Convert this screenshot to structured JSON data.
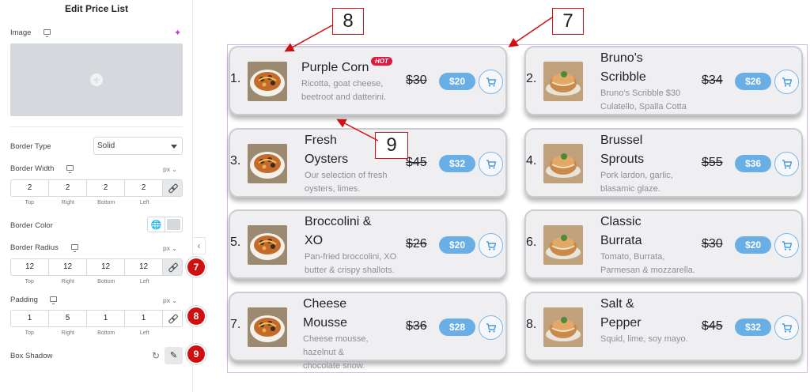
{
  "panel": {
    "title": "Edit Price List",
    "image_label": "Image",
    "border_type_label": "Border Type",
    "border_type_value": "Solid",
    "border_width_label": "Border Width",
    "border_width_unit": "px",
    "border_width_values": [
      "2",
      "2",
      "2",
      "2"
    ],
    "border_color_label": "Border Color",
    "border_radius_label": "Border Radius",
    "border_radius_unit": "px",
    "border_radius_values": [
      "12",
      "12",
      "12",
      "12"
    ],
    "padding_label": "Padding",
    "padding_unit": "px",
    "padding_values": [
      "1",
      "5",
      "1",
      "1"
    ],
    "side_labels": [
      "Top",
      "Right",
      "Bottom",
      "Left"
    ],
    "box_shadow_label": "Box Shadow",
    "badges": [
      "7",
      "8",
      "9"
    ]
  },
  "callouts": [
    "8",
    "7",
    "9"
  ],
  "items": [
    {
      "num": "1.",
      "title": [
        "Purple Corn"
      ],
      "hot": "HOT",
      "desc": [
        "Ricotta, goat cheese,",
        "beetroot and datterini."
      ],
      "old": "$30",
      "price": "$20"
    },
    {
      "num": "2.",
      "title": [
        "Bruno's",
        "Scribble"
      ],
      "desc": [
        "Bruno's Scribble $30",
        "Culatello, Spalla Cotta"
      ],
      "old": "$34",
      "price": "$26"
    },
    {
      "num": "3.",
      "title": [
        "Fresh",
        "Oysters"
      ],
      "desc": [
        "Our selection of fresh",
        "oysters, limes."
      ],
      "old": "$45",
      "price": "$32"
    },
    {
      "num": "4.",
      "title": [
        "Brussel",
        "Sprouts"
      ],
      "desc": [
        "Pork lardon, garlic,",
        "blasamic glaze."
      ],
      "old": "$55",
      "price": "$36"
    },
    {
      "num": "5.",
      "title": [
        "Broccolini &",
        "XO"
      ],
      "desc": [
        "Pan-fried broccolini, XO",
        "butter & crispy shallots."
      ],
      "old": "$26",
      "price": "$20"
    },
    {
      "num": "6.",
      "title": [
        "Classic",
        "Burrata"
      ],
      "desc": [
        "Tomato, Burrata,",
        "Parmesan & mozzarella."
      ],
      "old": "$30",
      "price": "$20"
    },
    {
      "num": "7.",
      "title": [
        "Cheese",
        "Mousse"
      ],
      "desc": [
        "Cheese mousse,",
        "hazelnut &",
        "chocolate snow."
      ],
      "old": "$36",
      "price": "$28"
    },
    {
      "num": "8.",
      "title": [
        "Salt &",
        "Pepper"
      ],
      "desc": [
        "Squid, lime, soy mayo."
      ],
      "old": "$45",
      "price": "$32"
    }
  ],
  "colors": {
    "price_badge": "#6aaee6",
    "hot_badge": "#e3163f",
    "annotation_red": "#d01010",
    "card_bg": "#efeff1"
  }
}
